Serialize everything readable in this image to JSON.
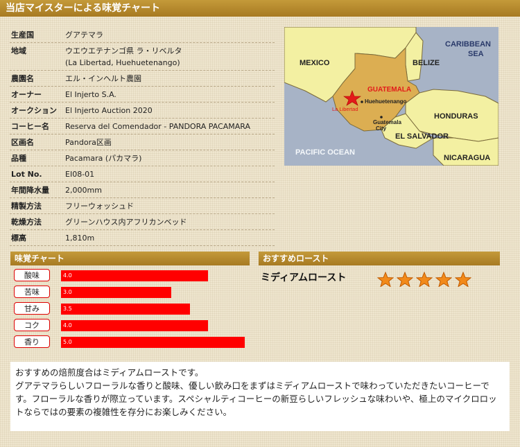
{
  "header": {
    "title": "当店マイスターによる味覚チャート"
  },
  "specs": [
    {
      "label": "生産国",
      "value": "グアテマラ"
    },
    {
      "label": "地域",
      "value": "ウエウエテナンゴ県 ラ・リベルタ",
      "sub": "(La Libertad, Huehuetenango)"
    },
    {
      "label": "農園名",
      "value": "エル・インヘルト農園"
    },
    {
      "label": "オーナー",
      "value": "El Injerto S.A."
    },
    {
      "label": "オークション",
      "value": "El Injerto Auction 2020"
    },
    {
      "label": "コーヒー名",
      "value": "Reserva del Comendador - PANDORA PACAMARA"
    },
    {
      "label": "区画名",
      "value": "Pandora区画"
    },
    {
      "label": "品種",
      "value": "Pacamara (パカマラ)"
    },
    {
      "label": "Lot No.",
      "value": "EI08-01"
    },
    {
      "label": "年間降水量",
      "value": "2,000mm"
    },
    {
      "label": "精製方法",
      "value": "フリーウォッシュド"
    },
    {
      "label": "乾燥方法",
      "value": "グリーンハウス内アフリカンベッド"
    },
    {
      "label": "標高",
      "value": "1,810m"
    }
  ],
  "map": {
    "labels": {
      "mexico": "MEXICO",
      "caribbean1": "CARIBBEAN",
      "caribbean2": "SEA",
      "belize": "BELIZE",
      "guatemala": "GUATEMALA",
      "huehuetenango": "Huehuetenango",
      "la_libertad": "La Libertad",
      "gc1": "Guatemala",
      "gc2": "City",
      "honduras": "HONDURAS",
      "el_salvador": "EL SALVADOR",
      "pacific": "PACIFIC OCEAN",
      "nicaragua": "NICARAGUA"
    },
    "colors": {
      "sea": "#a7b3c6",
      "land": "#f3f0a2",
      "guatemala": "#dcae52",
      "border": "#7a6a3a",
      "star": "#e31a1a"
    }
  },
  "taste_section": {
    "title": "味覚チャート"
  },
  "roast_section": {
    "title": "おすすめロースト",
    "roast": "ミディアムロースト",
    "stars": 5
  },
  "chart_data": {
    "type": "bar",
    "orientation": "horizontal",
    "categories": [
      "酸味",
      "苦味",
      "甘み",
      "コク",
      "香り"
    ],
    "values": [
      4.0,
      3.0,
      3.5,
      4.0,
      5.0
    ],
    "value_labels": [
      "4.0",
      "3.0",
      "3.5",
      "4.0",
      "5.0"
    ],
    "xlim": [
      0,
      5
    ],
    "bar_color": "#ff0000"
  },
  "comment": {
    "line1": "おすすめの焙煎度合はミディアムローストです。",
    "line2": "グアテマラらしいフローラルな香りと酸味、優しい飲み口をまずはミディアムローストで味わっていただきたいコーヒーです。フローラルな香りが際立っています。スペシャルティコーヒーの新豆らしいフレッシュな味わいや、極上のマイクロロットならではの要素の複雑性を存分にお楽しみください。"
  }
}
